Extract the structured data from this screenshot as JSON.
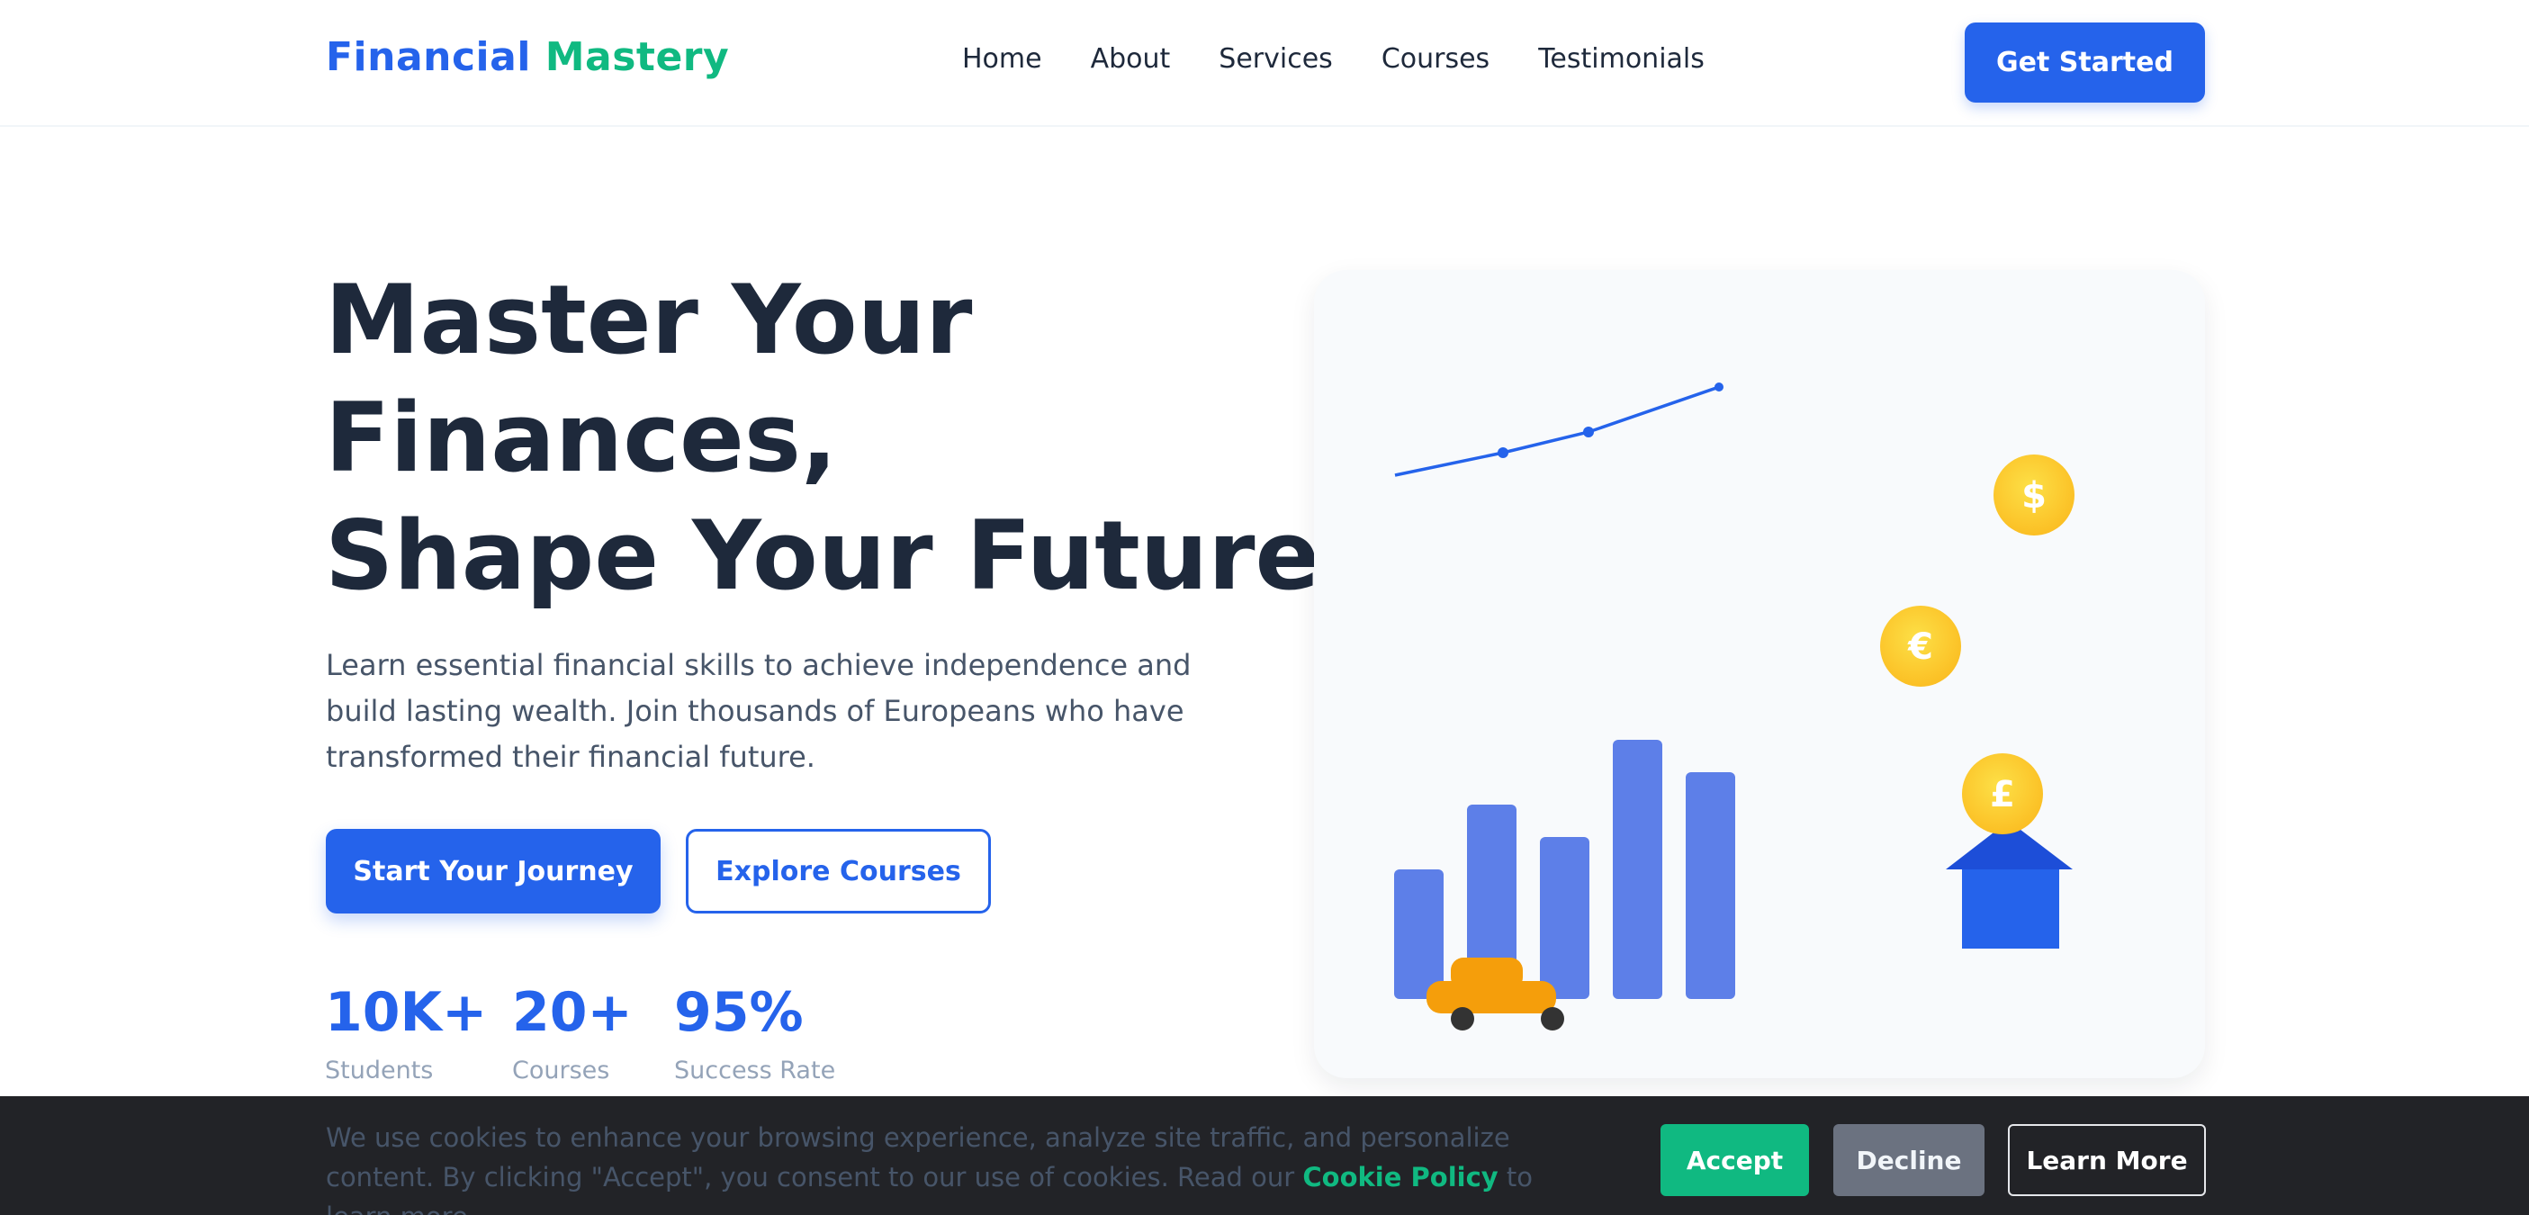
{
  "nav": {
    "logo_part1": "Financial",
    "logo_part2": "Mastery",
    "links": [
      "Home",
      "About",
      "Services",
      "Courses",
      "Testimonials"
    ],
    "cta": "Get Started"
  },
  "hero": {
    "title_line1": "Master Your",
    "title_line2": "Finances,",
    "title_line3": "Shape Your Future",
    "subtitle": "Learn essential financial skills to achieve independence and build lasting wealth. Join thousands of Europeans who have transformed their financial future.",
    "primary_button": "Start Your Journey",
    "secondary_button": "Explore Courses",
    "stats": [
      {
        "value": "10K+",
        "label": "Students"
      },
      {
        "value": "20+",
        "label": "Courses"
      },
      {
        "value": "95%",
        "label": "Success Rate"
      }
    ]
  },
  "illustration": {
    "coins": [
      "$",
      "€",
      "£"
    ],
    "colors": {
      "bar": "#4f74e6",
      "line": "#2563eb",
      "coin": "#fbbf24",
      "house": "#2563eb",
      "car": "#f59e0b"
    }
  },
  "cookie": {
    "text_before": "We use cookies to enhance your browsing experience, analyze site traffic, and personalize content. By clicking \"Accept\", you consent to our use of cookies. Read our ",
    "link": "Cookie Policy",
    "text_after": " to learn more.",
    "accept": "Accept",
    "decline": "Decline",
    "learn_more": "Learn More"
  },
  "colors": {
    "primary": "#2563eb",
    "secondary": "#10b981",
    "dark": "#1e293b",
    "muted": "#94a3b8"
  }
}
